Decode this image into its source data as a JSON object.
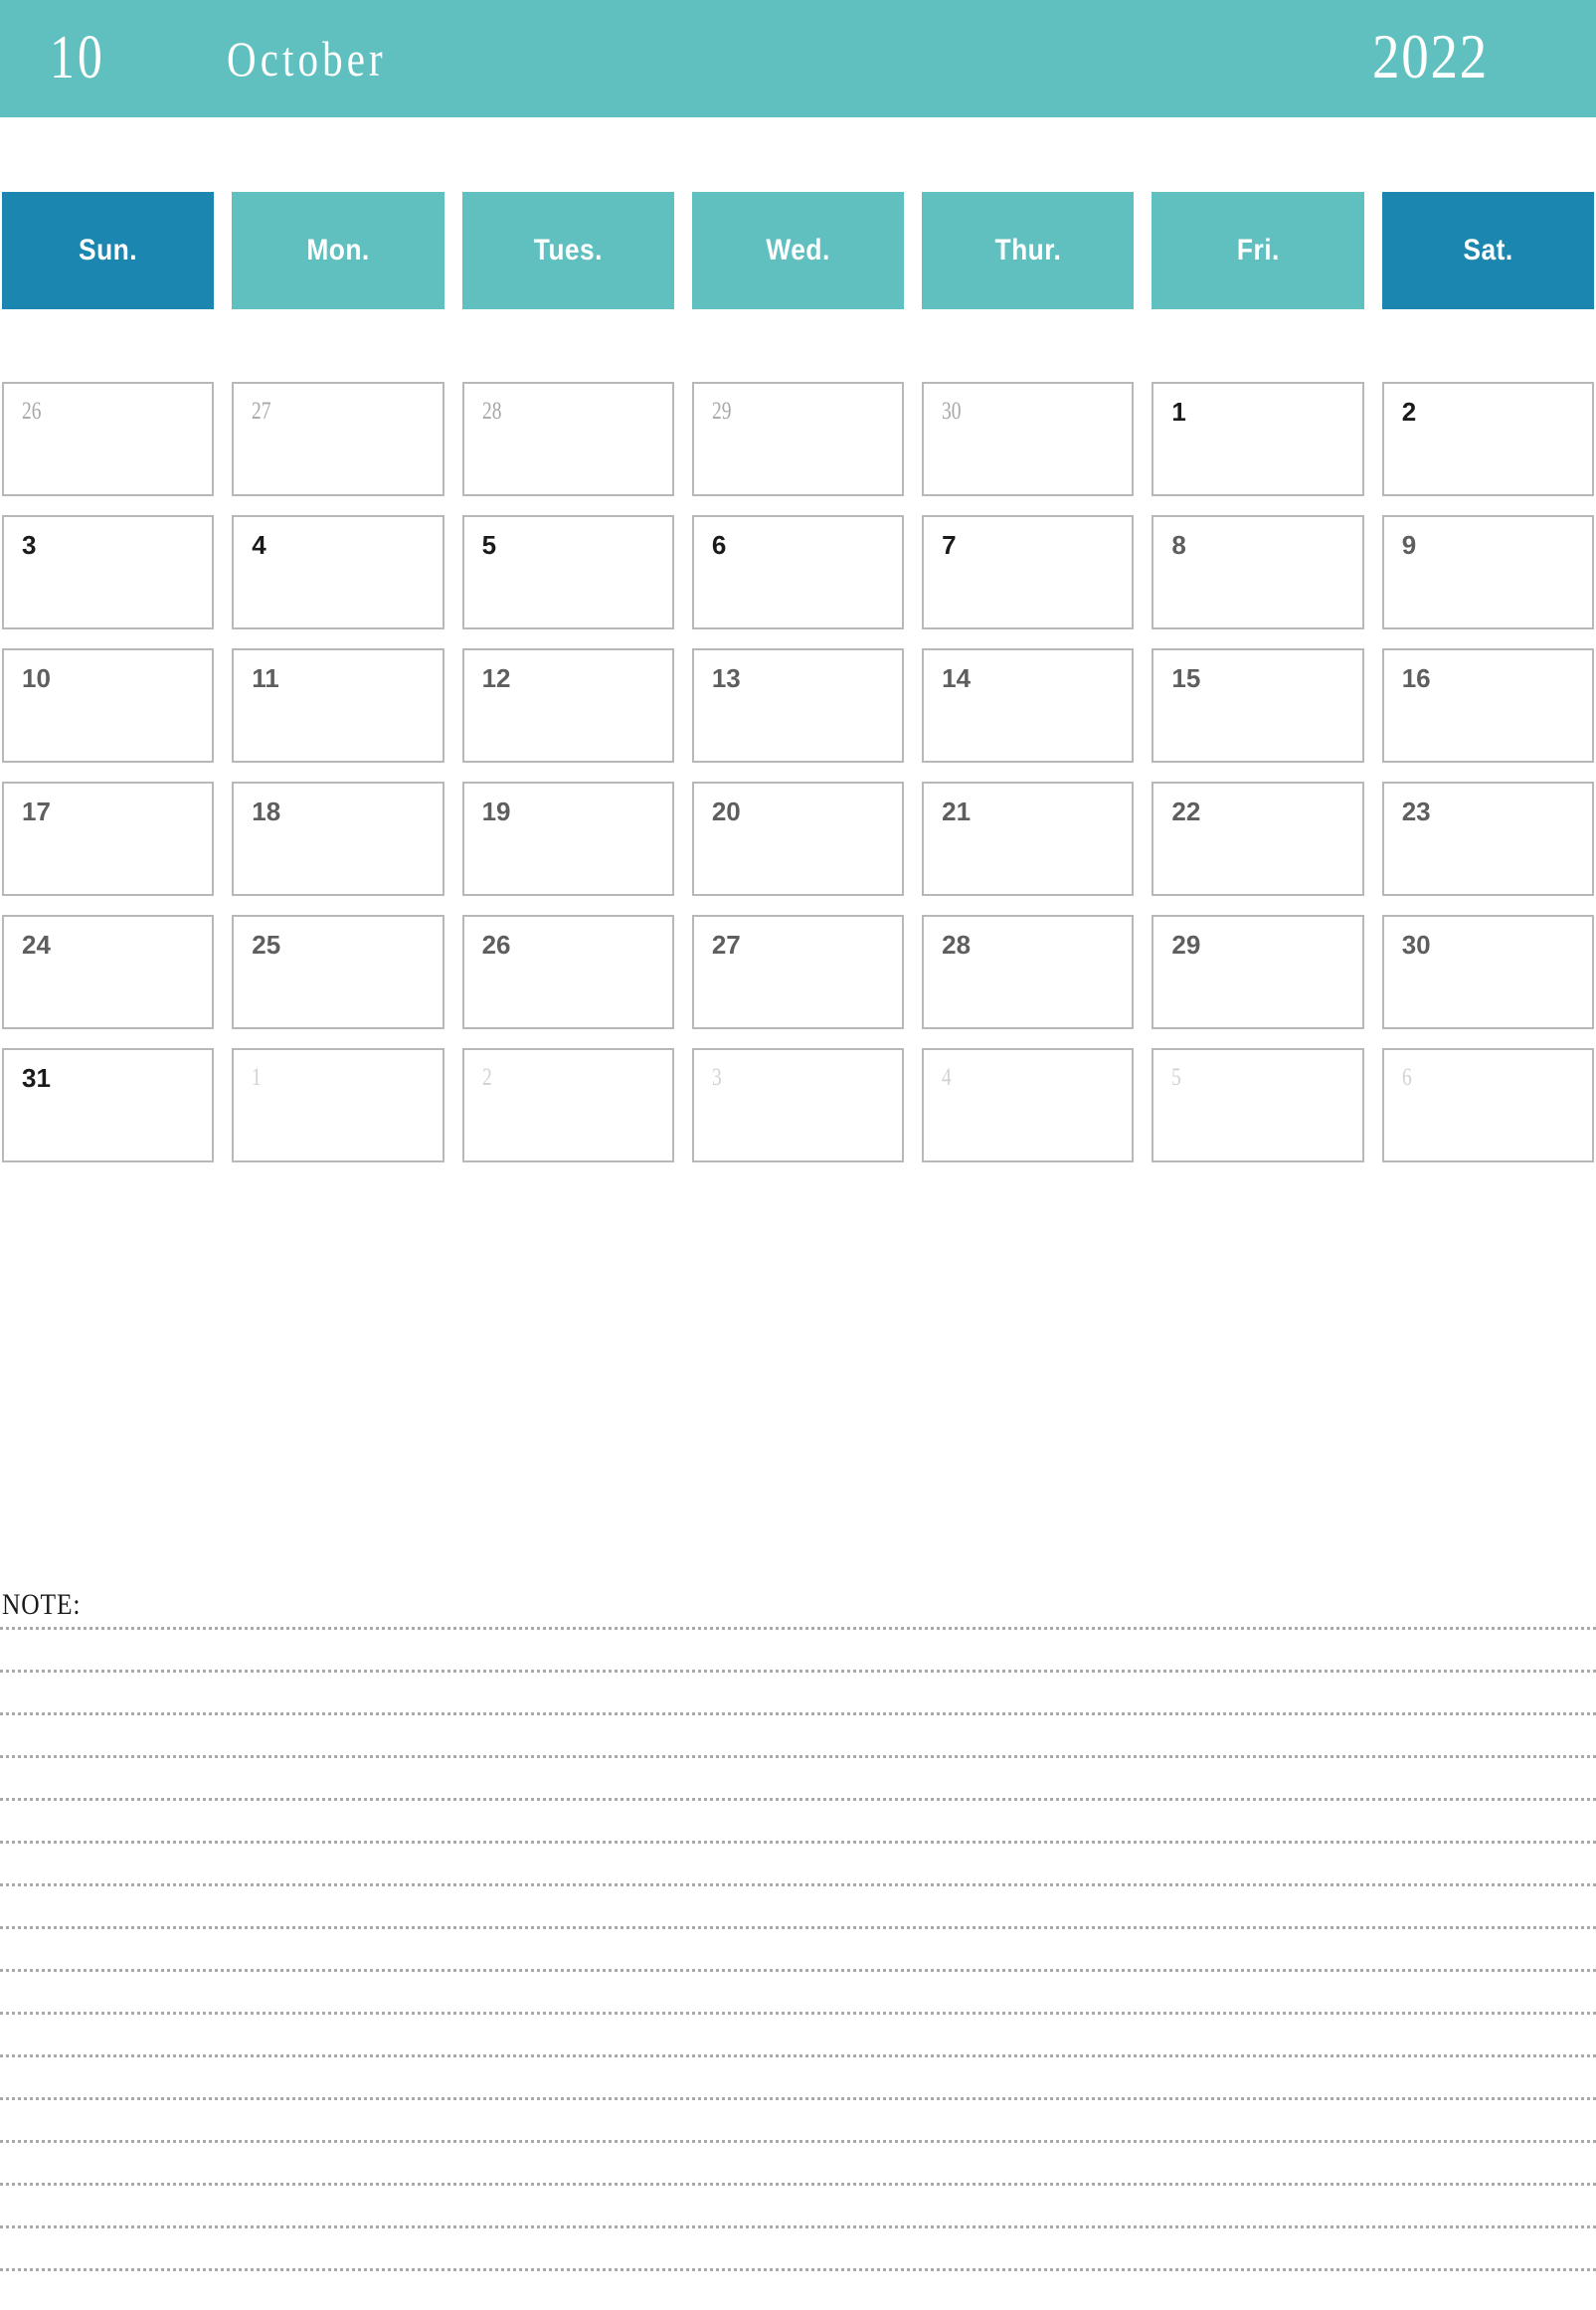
{
  "header": {
    "month_number": "10",
    "month_name": "October",
    "year": "2022",
    "bg_color": "#5fc0bf"
  },
  "weekdays": {
    "accent_color": "#1b87b0",
    "normal_color": "#5fc0bf",
    "items": [
      {
        "label": "Sun.",
        "accent": true
      },
      {
        "label": "Mon.",
        "accent": false
      },
      {
        "label": "Tues.",
        "accent": false
      },
      {
        "label": "Wed.",
        "accent": false
      },
      {
        "label": "Thur.",
        "accent": false
      },
      {
        "label": "Fri.",
        "accent": false
      },
      {
        "label": "Sat.",
        "accent": true
      }
    ]
  },
  "calendar": {
    "weeks": [
      [
        {
          "day": "26",
          "tone": "muted",
          "in_month": false
        },
        {
          "day": "27",
          "tone": "muted",
          "in_month": false
        },
        {
          "day": "28",
          "tone": "muted",
          "in_month": false
        },
        {
          "day": "29",
          "tone": "muted",
          "in_month": false
        },
        {
          "day": "30",
          "tone": "muted",
          "in_month": false
        },
        {
          "day": "1",
          "tone": "dark",
          "in_month": true
        },
        {
          "day": "2",
          "tone": "dark",
          "in_month": true
        }
      ],
      [
        {
          "day": "3",
          "tone": "dark",
          "in_month": true
        },
        {
          "day": "4",
          "tone": "dark",
          "in_month": true
        },
        {
          "day": "5",
          "tone": "dark",
          "in_month": true
        },
        {
          "day": "6",
          "tone": "dark",
          "in_month": true
        },
        {
          "day": "7",
          "tone": "dark",
          "in_month": true
        },
        {
          "day": "8",
          "tone": "mid",
          "in_month": true
        },
        {
          "day": "9",
          "tone": "mid",
          "in_month": true
        }
      ],
      [
        {
          "day": "10",
          "tone": "mid",
          "in_month": true
        },
        {
          "day": "11",
          "tone": "mid",
          "in_month": true
        },
        {
          "day": "12",
          "tone": "mid",
          "in_month": true
        },
        {
          "day": "13",
          "tone": "mid",
          "in_month": true
        },
        {
          "day": "14",
          "tone": "mid",
          "in_month": true
        },
        {
          "day": "15",
          "tone": "mid",
          "in_month": true
        },
        {
          "day": "16",
          "tone": "mid",
          "in_month": true
        }
      ],
      [
        {
          "day": "17",
          "tone": "mid",
          "in_month": true
        },
        {
          "day": "18",
          "tone": "mid",
          "in_month": true
        },
        {
          "day": "19",
          "tone": "mid",
          "in_month": true
        },
        {
          "day": "20",
          "tone": "mid",
          "in_month": true
        },
        {
          "day": "21",
          "tone": "mid",
          "in_month": true
        },
        {
          "day": "22",
          "tone": "mid",
          "in_month": true
        },
        {
          "day": "23",
          "tone": "mid",
          "in_month": true
        }
      ],
      [
        {
          "day": "24",
          "tone": "mid",
          "in_month": true
        },
        {
          "day": "25",
          "tone": "mid",
          "in_month": true
        },
        {
          "day": "26",
          "tone": "mid",
          "in_month": true
        },
        {
          "day": "27",
          "tone": "mid",
          "in_month": true
        },
        {
          "day": "28",
          "tone": "mid",
          "in_month": true
        },
        {
          "day": "29",
          "tone": "mid",
          "in_month": true
        },
        {
          "day": "30",
          "tone": "mid",
          "in_month": true
        }
      ],
      [
        {
          "day": "31",
          "tone": "dark",
          "in_month": true
        },
        {
          "day": "1",
          "tone": "faint",
          "in_month": false
        },
        {
          "day": "2",
          "tone": "faint",
          "in_month": false
        },
        {
          "day": "3",
          "tone": "faint",
          "in_month": false
        },
        {
          "day": "4",
          "tone": "faint",
          "in_month": false
        },
        {
          "day": "5",
          "tone": "faint",
          "in_month": false
        },
        {
          "day": "6",
          "tone": "faint",
          "in_month": false
        }
      ]
    ]
  },
  "note": {
    "label": "NOTE:",
    "line_count": 16
  }
}
